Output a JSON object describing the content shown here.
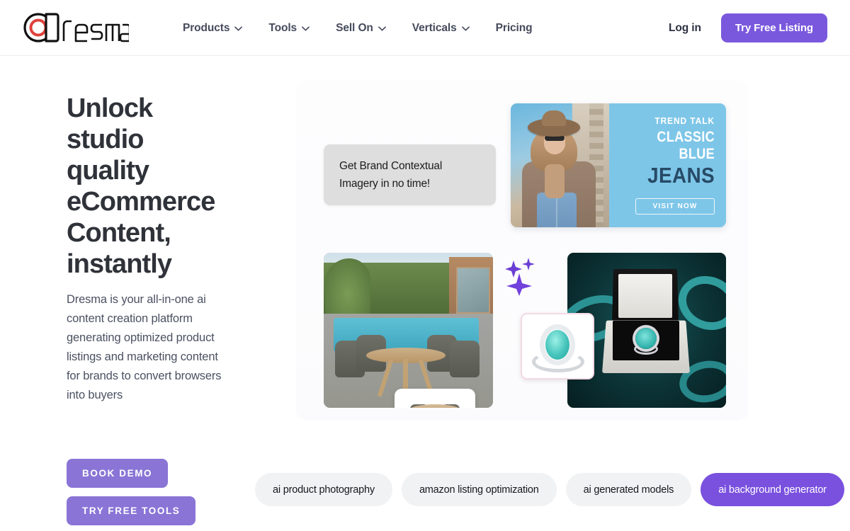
{
  "brand": {
    "name": "dresma",
    "logo_icon": "dresma-aperture-logo",
    "accent_color": "#7a58dd",
    "accent_light": "#8a74d6",
    "pill_active_color": "#7a50de"
  },
  "header": {
    "nav": [
      {
        "label": "Products",
        "has_dropdown": true,
        "icon": "chevron-down-icon"
      },
      {
        "label": "Tools",
        "has_dropdown": true,
        "icon": "chevron-down-icon"
      },
      {
        "label": "Sell On",
        "has_dropdown": true,
        "icon": "chevron-down-icon"
      },
      {
        "label": "Verticals",
        "has_dropdown": true,
        "icon": "chevron-down-icon"
      },
      {
        "label": "Pricing",
        "has_dropdown": false,
        "icon": ""
      }
    ],
    "login_label": "Log in",
    "cta_label": "Try Free Listing"
  },
  "hero": {
    "headline": "Unlock studio quality eCommerce Content, instantly",
    "subtext": "Dresma is your all-in-one ai content creation platform generating optimized product listings and marketing content for brands to convert browsers into buyers",
    "buttons": [
      {
        "label": "BOOK DEMO"
      },
      {
        "label": "TRY FREE TOOLS"
      }
    ]
  },
  "collage": {
    "brand_card_text": "Get Brand Contextual Imagery in no time!",
    "banner": {
      "eyebrow": "TREND TALK",
      "line1": "CLASSIC BLUE",
      "line2": "JEANS",
      "cta": "VISIT NOW",
      "photo_alt": "woman-in-hat-and-blue-jeans-photo"
    },
    "patio_alt": "outdoor-patio-dining-set-photo",
    "patio_inset_alt": "patio-dining-set-product-cutout",
    "jewelry_alt": "emerald-ring-in-gift-box-photo",
    "jewelry_inset_alt": "emerald-halo-ring-product-cutout",
    "sparkles_icon": "sparkles-icon"
  },
  "pills": [
    {
      "label": "ai product photography",
      "active": false
    },
    {
      "label": "amazon listing optimization",
      "active": false
    },
    {
      "label": "ai generated models",
      "active": false
    },
    {
      "label": "ai background generator",
      "active": true
    }
  ]
}
